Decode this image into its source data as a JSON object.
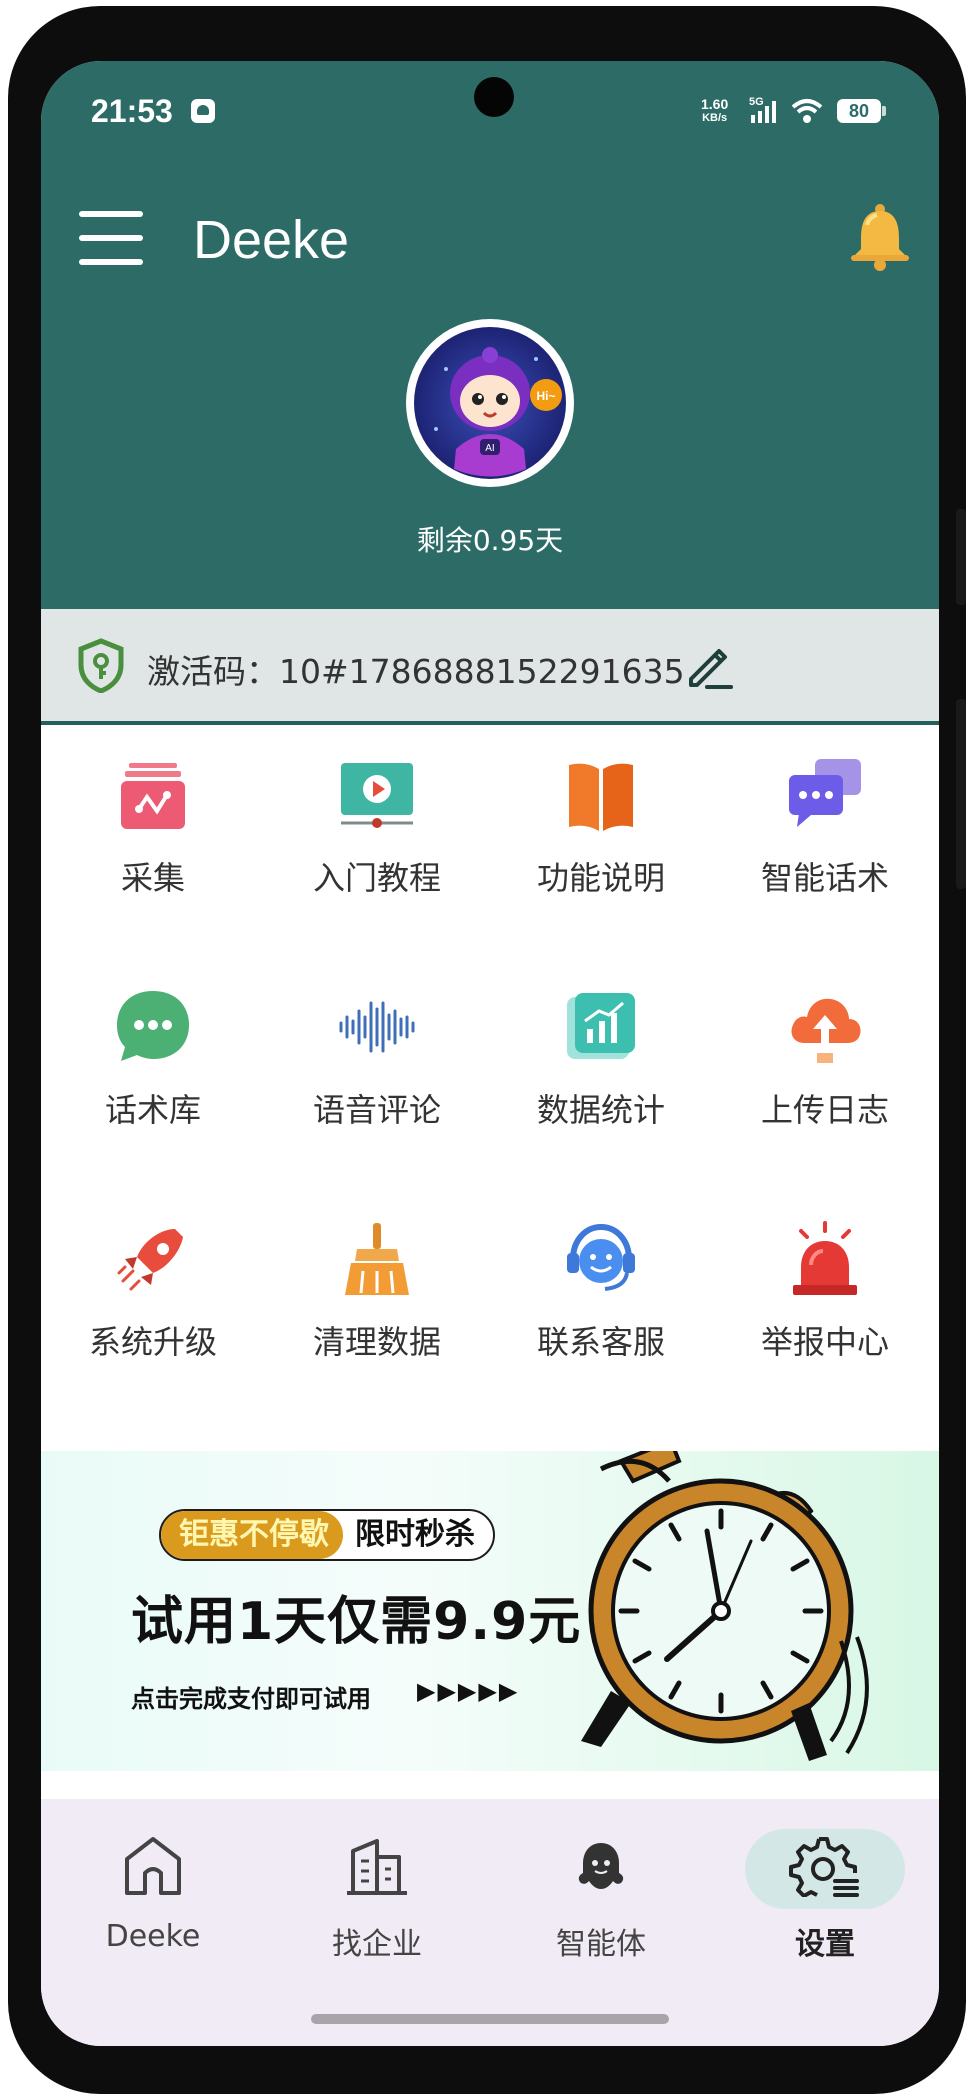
{
  "status_bar": {
    "time": "21:53",
    "net_speed_value": "1.60",
    "net_speed_unit": "KB/s",
    "network": "5G",
    "battery": "80"
  },
  "header": {
    "title": "Deeke",
    "remaining": "剩余0.95天",
    "avatar_badge": "Hi~",
    "avatar_chest": "AI"
  },
  "activation": {
    "label": "激活码：10#1786888152291635"
  },
  "grid_items": [
    {
      "label": "采集",
      "icon": "collect-icon"
    },
    {
      "label": "入门教程",
      "icon": "video-tutorial-icon"
    },
    {
      "label": "功能说明",
      "icon": "book-icon"
    },
    {
      "label": "智能话术",
      "icon": "chat-bubbles-icon"
    },
    {
      "label": "话术库",
      "icon": "message-icon"
    },
    {
      "label": "语音评论",
      "icon": "voice-wave-icon"
    },
    {
      "label": "数据统计",
      "icon": "chart-icon"
    },
    {
      "label": "上传日志",
      "icon": "cloud-upload-icon"
    },
    {
      "label": "系统升级",
      "icon": "rocket-icon"
    },
    {
      "label": "清理数据",
      "icon": "broom-icon"
    },
    {
      "label": "联系客服",
      "icon": "support-icon"
    },
    {
      "label": "举报中心",
      "icon": "alarm-light-icon"
    }
  ],
  "banner": {
    "tag_left": "钜惠不停歇",
    "tag_right": "限时秒杀",
    "title": "试用1天仅需9.9元",
    "subtitle": "点击完成支付即可试用",
    "arrows": "▶▶▶▶▶"
  },
  "bottom_nav": [
    {
      "label": "Deeke",
      "icon": "home-icon",
      "active": false
    },
    {
      "label": "找企业",
      "icon": "building-icon",
      "active": false
    },
    {
      "label": "智能体",
      "icon": "agent-icon",
      "active": false
    },
    {
      "label": "设置",
      "icon": "settings-icon",
      "active": true
    }
  ],
  "colors": {
    "header_bg": "#2c6b66",
    "accent": "#24605b",
    "nav_bg": "#f1ebf6"
  }
}
